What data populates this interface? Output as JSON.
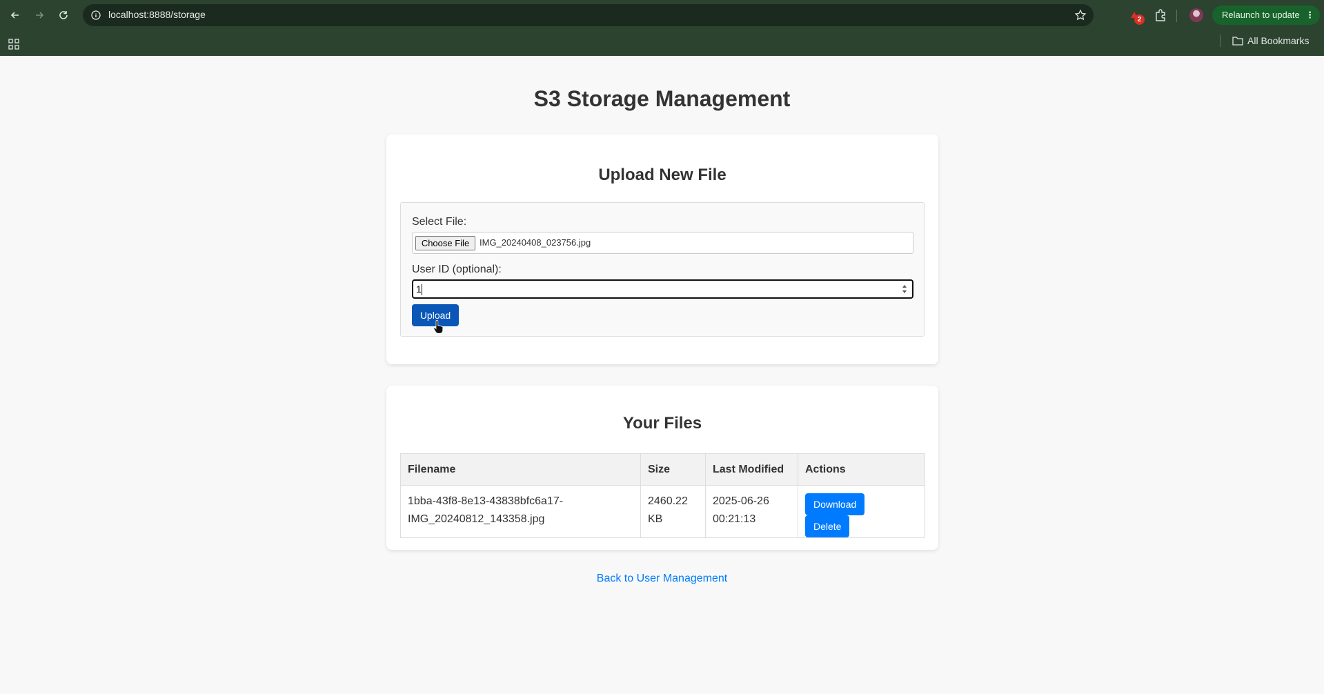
{
  "browser": {
    "url": "localhost:8888/storage",
    "extension_badge": "2",
    "relaunch_label": "Relaunch to update",
    "bookmarks_label": "All Bookmarks"
  },
  "page": {
    "title": "S3 Storage Management",
    "back_link": "Back to User Management"
  },
  "upload": {
    "heading": "Upload New File",
    "select_file_label": "Select File:",
    "choose_file_button": "Choose File",
    "selected_file": "IMG_20240408_023756.jpg",
    "user_id_label": "User ID (optional):",
    "user_id_value": "1",
    "upload_button": "Upload"
  },
  "files": {
    "heading": "Your Files",
    "columns": [
      "Filename",
      "Size",
      "Last Modified",
      "Actions"
    ],
    "rows": [
      {
        "filename_line1": "1bba-43f8-8e13-43838bfc6a17-",
        "filename_line2": "IMG_20240812_143358.jpg",
        "size_line1": "2460.22",
        "size_line2": "KB",
        "modified_line1": "2025-06-26",
        "modified_line2": "00:21:13",
        "download_label": "Download",
        "delete_label": "Delete"
      }
    ]
  },
  "colors": {
    "chrome": "#2c4330",
    "primary_button": "#007bff",
    "upload_button": "#0a57b8",
    "link": "#007bff"
  }
}
